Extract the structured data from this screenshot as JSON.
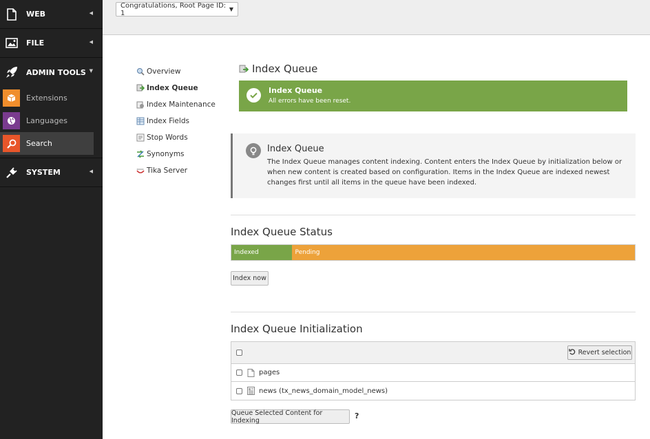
{
  "sidebar": {
    "groups": [
      {
        "label": "WEB",
        "icon": "file-icon"
      },
      {
        "label": "FILE",
        "icon": "image-icon"
      },
      {
        "label": "ADMIN TOOLS",
        "icon": "rocket-icon"
      },
      {
        "label": "SYSTEM",
        "icon": "plug-icon"
      }
    ],
    "admin_items": [
      {
        "label": "Extensions",
        "icon": "box-icon",
        "color": "#f08e2c"
      },
      {
        "label": "Languages",
        "icon": "globe-icon",
        "color": "#7a3b8f"
      },
      {
        "label": "Search",
        "icon": "search-icon",
        "color": "#e8562a"
      }
    ]
  },
  "topbar": {
    "page_select": "Congratulations, Root Page ID: 1"
  },
  "subnav": {
    "items": [
      {
        "label": "Overview",
        "icon": "magnifier-icon"
      },
      {
        "label": "Index Queue",
        "icon": "queue-icon"
      },
      {
        "label": "Index Maintenance",
        "icon": "maintenance-icon"
      },
      {
        "label": "Index Fields",
        "icon": "fields-icon"
      },
      {
        "label": "Stop Words",
        "icon": "stopwords-icon"
      },
      {
        "label": "Synonyms",
        "icon": "synonyms-icon"
      },
      {
        "label": "Tika Server",
        "icon": "tika-icon"
      }
    ]
  },
  "main": {
    "title": "Index Queue",
    "flash": {
      "title": "Index Queue",
      "message": "All errors have been reset."
    },
    "info": {
      "title": "Index Queue",
      "message": "The Index Queue manages content indexing. Content enters the Index Queue by initialization below or when new content is created based on configuration. Items in the Index Queue are indexed newest changes first until all items in the queue have been indexed."
    },
    "status": {
      "heading": "Index Queue Status",
      "indexed_label": "Indexed",
      "pending_label": "Pending",
      "indexed_fraction": 0.151,
      "indexed_color": "#79a548",
      "pending_color": "#eda23a",
      "index_button": "Index now"
    },
    "init": {
      "heading": "Index Queue Initialization",
      "revert_button": "Revert selection",
      "rows": [
        {
          "label": "pages",
          "icon": "page-icon"
        },
        {
          "label": "news (tx_news_domain_model_news)",
          "icon": "news-icon"
        }
      ],
      "queue_button": "Queue Selected Content for Indexing",
      "help": "?"
    }
  }
}
